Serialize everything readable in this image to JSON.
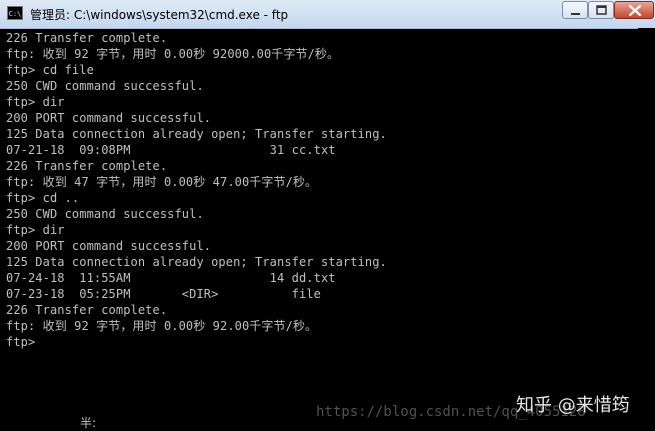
{
  "window": {
    "title": "管理员: C:\\windows\\system32\\cmd.exe - ftp",
    "icon": "cmd-icon",
    "controls": [
      "minimize-icon",
      "maximize-icon",
      "close-icon"
    ]
  },
  "console": {
    "lines": [
      "226 Transfer complete.",
      "ftp: 收到 92 字节，用时 0.00秒 92000.00千字节/秒。",
      "ftp> cd file",
      "250 CWD command successful.",
      "ftp> dir",
      "200 PORT command successful.",
      "125 Data connection already open; Transfer starting.",
      "07-21-18  09:08PM                   31 cc.txt",
      "226 Transfer complete.",
      "ftp: 收到 47 字节，用时 0.00秒 47.00千字节/秒。",
      "ftp> cd ..",
      "250 CWD command successful.",
      "ftp> dir",
      "200 PORT command successful.",
      "125 Data connection already open; Transfer starting.",
      "07-24-18  11:55AM                   14 dd.txt",
      "07-23-18  05:25PM       <DIR>          file",
      "226 Transfer complete.",
      "ftp: 收到 92 字节，用时 0.00秒 92.00千字节/秒。",
      "ftp>"
    ]
  },
  "ime_status": "半:",
  "watermark": {
    "blog": "https://blog.csdn.net/qq_4055128",
    "brand": "知乎 @来惜筠"
  },
  "colors": {
    "console_bg": "#000000",
    "console_text": "#c0c0c0"
  }
}
